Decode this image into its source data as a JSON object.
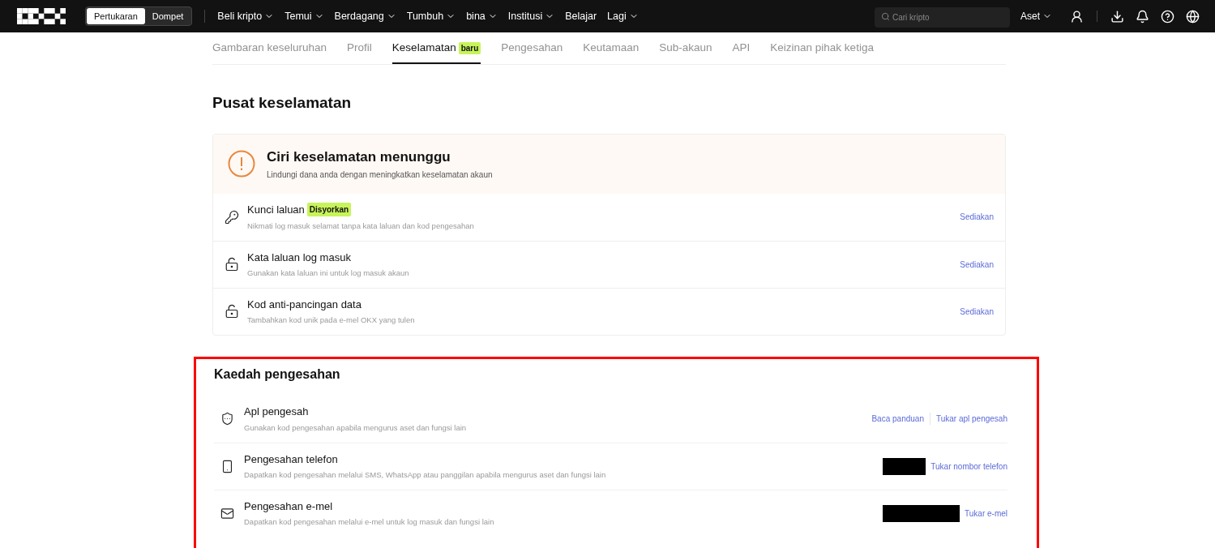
{
  "topbar": {
    "mode_toggle": [
      {
        "label": "Pertukaran",
        "selected": true
      },
      {
        "label": "Dompet",
        "selected": false
      }
    ],
    "nav": [
      {
        "label": "Beli kripto",
        "has_menu": true
      },
      {
        "label": "Temui",
        "has_menu": true
      },
      {
        "label": "Berdagang",
        "has_menu": true
      },
      {
        "label": "Tumbuh",
        "has_menu": true
      },
      {
        "label": "bina",
        "has_menu": true
      },
      {
        "label": "Institusi",
        "has_menu": true
      },
      {
        "label": "Belajar",
        "has_menu": false
      },
      {
        "label": "Lagi",
        "has_menu": true
      }
    ],
    "search": {
      "placeholder": "Cari kripto"
    },
    "assets": {
      "label": "Aset",
      "has_menu": true
    }
  },
  "tabs": [
    {
      "label": "Gambaran keseluruhan",
      "selected": false
    },
    {
      "label": "Profil",
      "selected": false
    },
    {
      "label": "Keselamatan",
      "selected": true,
      "badge": "baru"
    },
    {
      "label": "Pengesahan",
      "selected": false
    },
    {
      "label": "Keutamaan",
      "selected": false
    },
    {
      "label": "Sub-akaun",
      "selected": false
    },
    {
      "label": "API",
      "selected": false
    },
    {
      "label": "Keizinan pihak ketiga",
      "selected": false
    }
  ],
  "page_title": "Pusat keselamatan",
  "pending": {
    "title": "Ciri keselamatan menunggu",
    "subtitle": "Lindungi dana anda dengan meningkatkan keselamatan akaun",
    "items": [
      {
        "kind": "passkey",
        "title": "Kunci laluan",
        "badge": "Disyorkan",
        "description": "Nikmati log masuk selamat tanpa kata laluan dan kod pengesahan",
        "action": "Sediakan"
      },
      {
        "kind": "password",
        "title": "Kata laluan log masuk",
        "description": "Gunakan kata laluan ini untuk log masuk akaun",
        "action": "Sediakan"
      },
      {
        "kind": "antiphishing",
        "title": "Kod anti-pancingan data",
        "description": "Tambahkan kod unik pada e-mel OKX yang tulen",
        "action": "Sediakan"
      }
    ]
  },
  "methods": {
    "title": "Kaedah pengesahan",
    "highlighted": true,
    "items": [
      {
        "kind": "authenticator",
        "title": "Apl pengesah",
        "description": "Gunakan kod pengesahan apabila mengurus aset dan fungsi lain",
        "redacted": false,
        "actions": [
          "Baca panduan",
          "Tukar apl pengesah"
        ]
      },
      {
        "kind": "phone",
        "title": "Pengesahan telefon",
        "description": "Dapatkan kod pengesahan melalui SMS, WhatsApp atau panggilan apabila mengurus aset dan fungsi lain",
        "redacted": true,
        "actions": [
          "Tukar nombor telefon"
        ]
      },
      {
        "kind": "email",
        "title": "Pengesahan e-mel",
        "description": "Dapatkan kod pengesahan melalui e-mel untuk log masuk dan fungsi lain",
        "redacted": true,
        "actions": [
          "Tukar e-mel"
        ]
      }
    ]
  }
}
